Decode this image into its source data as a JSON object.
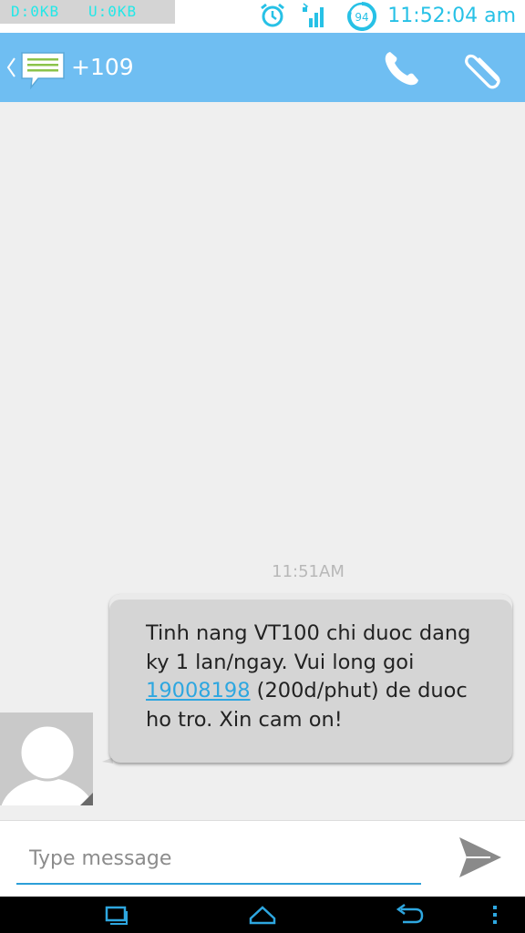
{
  "status_bar": {
    "download": "D:0KB",
    "upload": "U:0KB",
    "battery_level": "94",
    "time": "11:52:04 am",
    "icons": [
      "alarm-icon",
      "signal-icon",
      "battery-icon"
    ]
  },
  "action_bar": {
    "contact": "+109",
    "icons": [
      "back-chevron-icon",
      "messaging-app-icon",
      "phone-icon",
      "paperclip-icon"
    ]
  },
  "conversation": {
    "timestamp": "11:51AM",
    "message": {
      "text_before": "Tinh nang VT100 chi duoc dang ky 1 lan/ngay. Vui long goi ",
      "link": "19008198",
      "text_after": " (200d/phut) de duoc ho tro. Xin cam on!"
    }
  },
  "compose": {
    "placeholder": "Type message",
    "value": ""
  },
  "nav_bar": {
    "icons": [
      "recent-apps-icon",
      "home-icon",
      "back-icon",
      "menu-icon"
    ]
  },
  "colors": {
    "action_bar": "#6fbef2",
    "accent": "#27c1e6",
    "bubble": "#d5d5d5",
    "link": "#2ea7e0",
    "background": "#efefef"
  }
}
